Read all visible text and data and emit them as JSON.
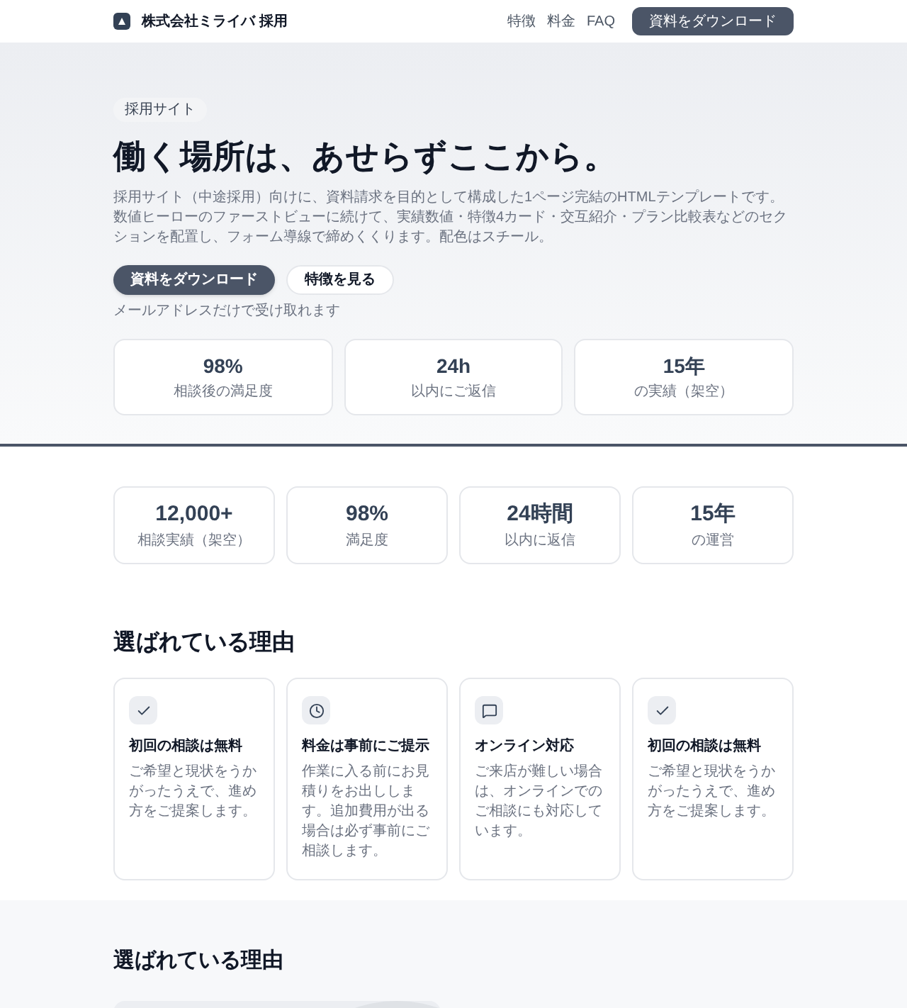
{
  "header": {
    "brand": "株式会社ミライバ 採用",
    "nav": [
      "特徴",
      "料金",
      "FAQ"
    ],
    "cta": "資料をダウンロード"
  },
  "hero": {
    "badge": "採用サイト",
    "title": "働く場所は、あせらずここから。",
    "lead": "採用サイト（中途採用）向けに、資料請求を目的として構成した1ページ完結のHTMLテンプレートです。数値ヒーローのファーストビューに続けて、実績数値・特徴4カード・交互紹介・プラン比較表などのセクションを配置し、フォーム導線で締めくくります。配色はスチール。",
    "primary_button": "資料をダウンロード",
    "secondary_button": "特徴を見る",
    "note": "メールアドレスだけで受け取れます",
    "stats": [
      {
        "value": "98%",
        "label": "相談後の満足度"
      },
      {
        "value": "24h",
        "label": "以内にご返信"
      },
      {
        "value": "15年",
        "label": "の実績（架空）"
      }
    ]
  },
  "numbers": [
    {
      "value": "12,000+",
      "label": "相談実績（架空）"
    },
    {
      "value": "98%",
      "label": "満足度"
    },
    {
      "value": "24時間",
      "label": "以内に返信"
    },
    {
      "value": "15年",
      "label": "の運営"
    }
  ],
  "reasons": {
    "title": "選ばれている理由",
    "cards": [
      {
        "kind": "check",
        "title": "初回の相談は無料",
        "text": "ご希望と現状をうかがったうえで、進め方をご提案します。"
      },
      {
        "kind": "clock",
        "title": "料金は事前にご提示",
        "text": "作業に入る前にお見積りをお出しします。追加費用が出る場合は必ず事前にご相談します。"
      },
      {
        "kind": "chat",
        "title": "オンライン対応",
        "text": "ご来店が難しい場合は、オンラインでのご相談にも対応しています。"
      },
      {
        "kind": "check",
        "title": "初回の相談は無料",
        "text": "ご希望と現状をうかがったうえで、進め方をご提案します。"
      }
    ]
  },
  "alternating": {
    "title": "選ばれている理由"
  }
}
